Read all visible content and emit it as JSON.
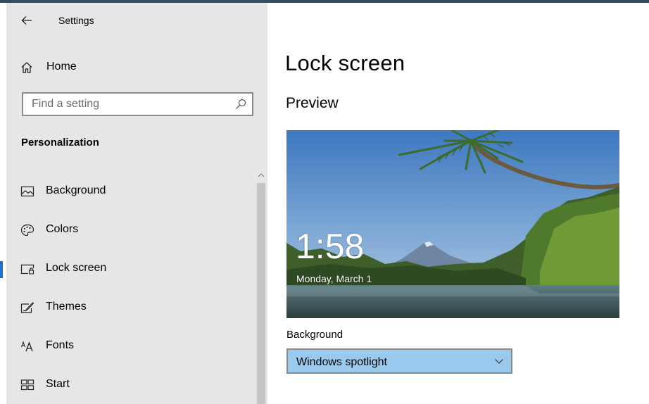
{
  "window": {
    "title": "Settings"
  },
  "sidebar": {
    "home_label": "Home",
    "search_placeholder": "Find a setting",
    "section_title": "Personalization",
    "items": [
      {
        "label": "Background",
        "icon": "picture-icon",
        "active": false
      },
      {
        "label": "Colors",
        "icon": "palette-icon",
        "active": false
      },
      {
        "label": "Lock screen",
        "icon": "lock-screen-icon",
        "active": true
      },
      {
        "label": "Themes",
        "icon": "themes-icon",
        "active": false
      },
      {
        "label": "Fonts",
        "icon": "fonts-icon",
        "active": false
      },
      {
        "label": "Start",
        "icon": "start-icon",
        "active": false
      }
    ]
  },
  "main": {
    "title": "Lock screen",
    "preview_title": "Preview",
    "preview": {
      "time": "1:58",
      "date": "Monday, March 1"
    },
    "background_label": "Background",
    "background_value": "Windows spotlight"
  },
  "colors": {
    "accent": "#1a73d6",
    "sidebar_bg": "#e6e6e6",
    "dropdown_bg": "#99c9ec"
  }
}
